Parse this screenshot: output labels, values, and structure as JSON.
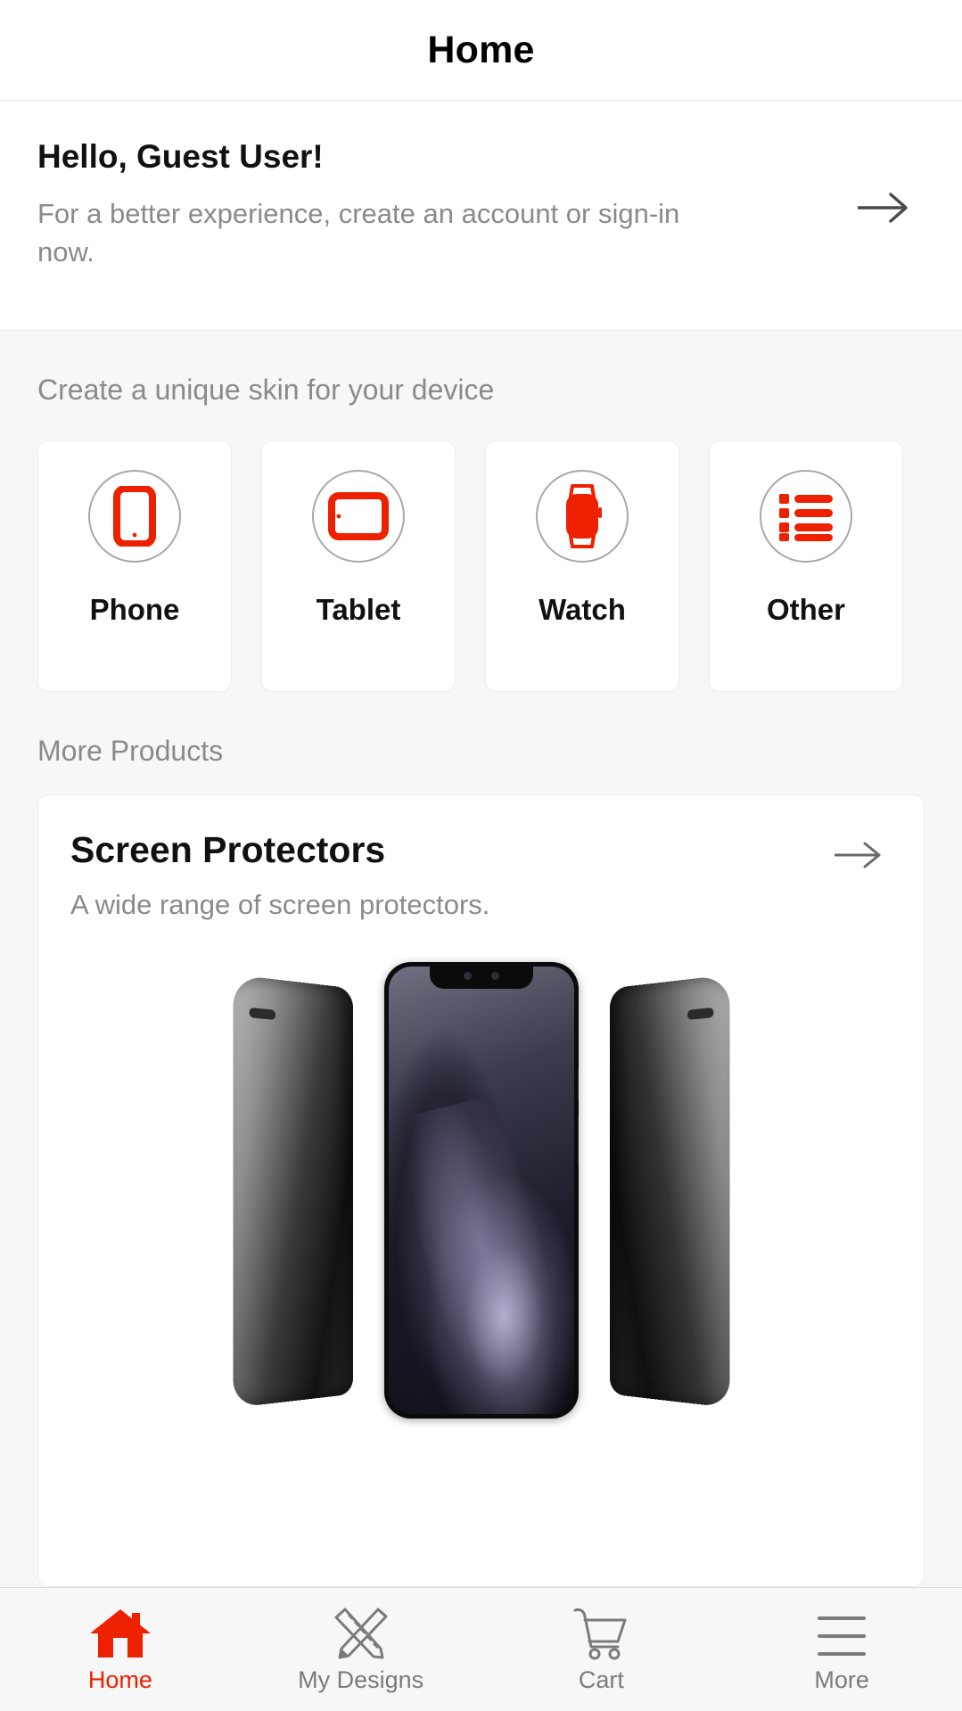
{
  "header": {
    "title": "Home"
  },
  "greeting": {
    "title": "Hello, Guest User!",
    "subtitle": "For a better experience, create an account or sign-in now.",
    "arrow_icon": "arrow-right-icon"
  },
  "device_section": {
    "label": "Create a unique skin for your device",
    "cards": [
      {
        "label": "Phone",
        "icon": "phone-icon"
      },
      {
        "label": "Tablet",
        "icon": "tablet-icon"
      },
      {
        "label": "Watch",
        "icon": "watch-icon"
      },
      {
        "label": "Other",
        "icon": "list-icon"
      }
    ]
  },
  "more_products": {
    "label": "More Products",
    "product": {
      "title": "Screen Protectors",
      "subtitle": "A wide range of screen protectors.",
      "arrow_icon": "arrow-right-icon",
      "image_alt": "three-phones-with-screen-protectors"
    }
  },
  "bottom_nav": {
    "items": [
      {
        "label": "Home",
        "icon": "home-icon",
        "active": true
      },
      {
        "label": "My Designs",
        "icon": "design-icon",
        "active": false
      },
      {
        "label": "Cart",
        "icon": "cart-icon",
        "active": false
      },
      {
        "label": "More",
        "icon": "menu-icon",
        "active": false
      }
    ]
  },
  "colors": {
    "accent_red": "#ED2000",
    "page_background": "#F7F7F7",
    "card_background": "#FFFFFF",
    "muted_text": "#8A8A8A",
    "primary_text": "#111111",
    "icon_gray": "#7B7B7B",
    "circle_ring": "#A8A8A8"
  }
}
